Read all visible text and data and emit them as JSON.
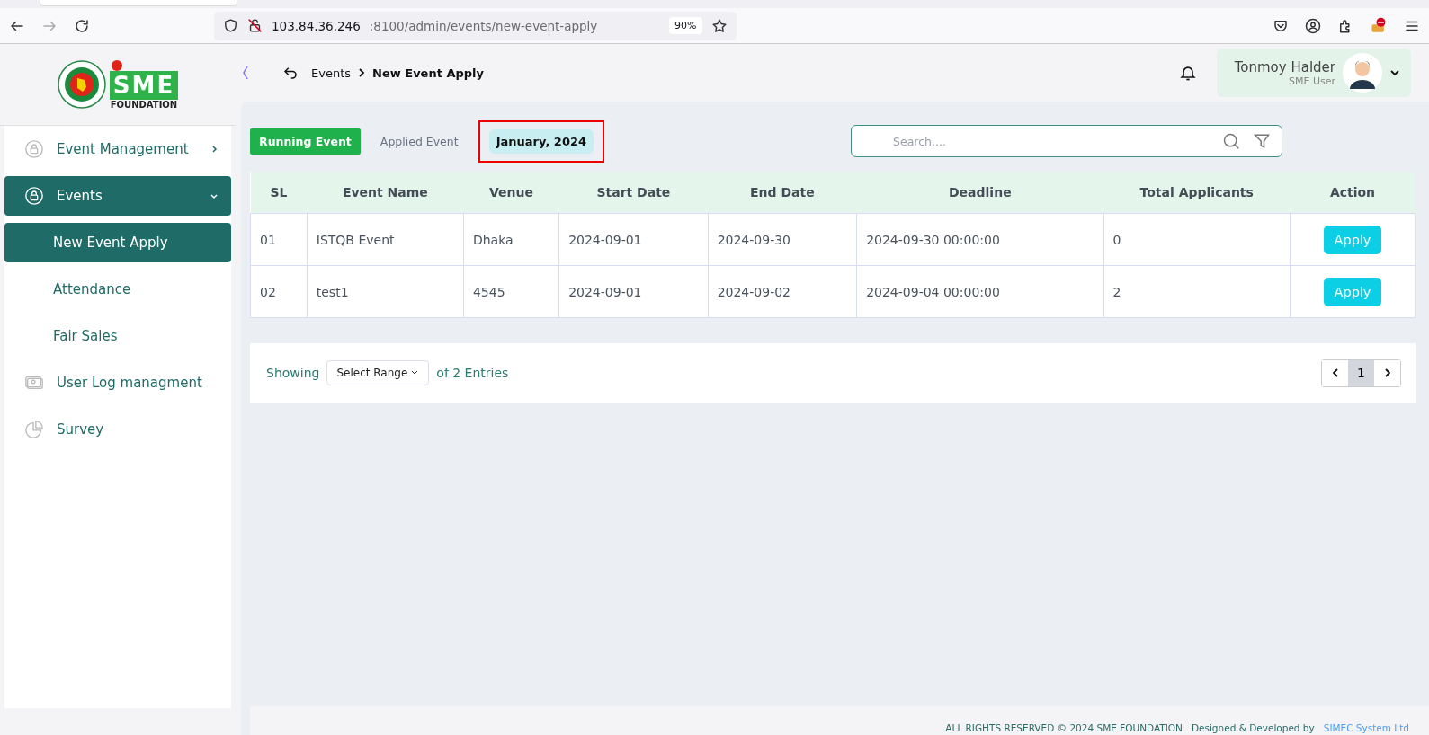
{
  "browser": {
    "url_host": "103.84.36.246",
    "url_rest": ":8100/admin/events/new-event-apply",
    "zoom": "90%"
  },
  "sidebar": {
    "logo": {
      "brand": "SME",
      "sub": "FOUNDATION"
    },
    "items": [
      {
        "label": "Event Management",
        "kind": "group",
        "selected": false,
        "expanded": false
      },
      {
        "label": "Events",
        "kind": "group",
        "selected": true,
        "expanded": true
      },
      {
        "label": "New Event Apply",
        "kind": "sub",
        "selected": true
      },
      {
        "label": "Attendance",
        "kind": "sub",
        "selected": false
      },
      {
        "label": "Fair Sales",
        "kind": "sub",
        "selected": false
      },
      {
        "label": "User Log managment",
        "kind": "leaf",
        "selected": false
      },
      {
        "label": "Survey",
        "kind": "leaf",
        "selected": false
      }
    ]
  },
  "header": {
    "breadcrumb": [
      "Events",
      "New Event Apply"
    ],
    "user": {
      "name": "Tonmoy Halder",
      "role": "SME User"
    }
  },
  "tabs": [
    {
      "label": "Running Event",
      "selected": true
    },
    {
      "label": "Applied Event",
      "selected": false
    }
  ],
  "month": {
    "label": "January, 2024",
    "highlighted": true
  },
  "search": {
    "placeholder": "Search...."
  },
  "table": {
    "columns": [
      "SL",
      "Event Name",
      "Venue",
      "Start Date",
      "End Date",
      "Deadline",
      "Total Applicants",
      "Action"
    ],
    "rows": [
      {
        "sl": "01",
        "name": "ISTQB Event",
        "venue": "Dhaka",
        "start": "2024-09-01",
        "end": "2024-09-30",
        "deadline": "2024-09-30 00:00:00",
        "applicants": "0",
        "action": "Apply"
      },
      {
        "sl": "02",
        "name": "test1",
        "venue": "4545",
        "start": "2024-09-01",
        "end": "2024-09-02",
        "deadline": "2024-09-04 00:00:00",
        "applicants": "2",
        "action": "Apply"
      }
    ]
  },
  "pagination": {
    "showing": "Showing",
    "range": "Select Range",
    "entries": "of 2 Entries",
    "pages": [
      {
        "label": "1",
        "selected": true
      }
    ]
  },
  "footer": {
    "rights": "ALL RIGHTS RESERVED © 2024 SME FOUNDATION",
    "designed": "Designed & Developed by",
    "company": "SIMEC System Ltd"
  }
}
